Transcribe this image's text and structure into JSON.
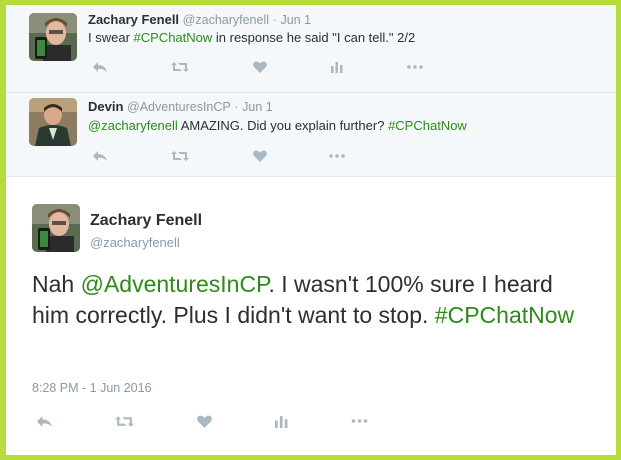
{
  "tweets": [
    {
      "name": "Zachary Fenell",
      "handle": "@zacharyfenell",
      "dot": "·",
      "time": "Jun 1",
      "text_pre": "I swear ",
      "hashtag": "#CPChatNow",
      "text_post": " in response he said \"I can tell.\" 2/2"
    },
    {
      "name": "Devin",
      "handle": "@AdventuresInCP",
      "dot": "·",
      "time": "Jun 1",
      "mention": "@zacharyfenell",
      "text_mid": " AMAZING. Did you explain further? ",
      "hashtag": "#CPChatNow"
    }
  ],
  "main_tweet": {
    "name": "Zachary Fenell",
    "handle": "@zacharyfenell",
    "text_pre": "Nah ",
    "mention": "@AdventuresInCP",
    "text_mid": ". I wasn't 100% sure I heard him correctly. Plus I didn't want to stop. ",
    "hashtag": "#CPChatNow",
    "timestamp": "8:28 PM - 1 Jun 2016"
  },
  "actions": [
    "reply-icon",
    "retweet-icon",
    "like-icon",
    "analytics-icon",
    "more-icon"
  ],
  "colors": {
    "border": "#b5dc3a",
    "hashtag": "#2f8a1a",
    "icon": "#aab8c2"
  }
}
